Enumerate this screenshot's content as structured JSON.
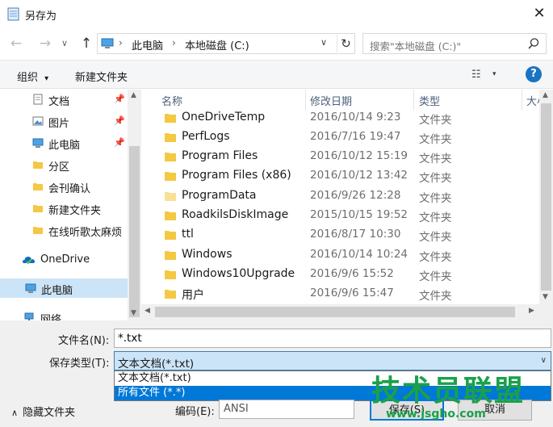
{
  "window": {
    "title": "另存为",
    "close_glyph": "✕"
  },
  "nav": {
    "back_glyph": "←",
    "forward_glyph": "→",
    "dropdown_glyph": "∨",
    "up_glyph": "↑",
    "breadcrumb": [
      "此电脑",
      "本地磁盘 (C:)"
    ],
    "crumb_separator": "›",
    "address_dropdown_glyph": "∨",
    "refresh_glyph": "↻",
    "search_placeholder": "搜索\"本地磁盘 (C:)\""
  },
  "toolbar": {
    "organize_label": "组织",
    "organize_caret": "▾",
    "new_folder_label": "新建文件夹",
    "view_glyph": "☷",
    "view_caret": "▾",
    "help_glyph": "?"
  },
  "sidebar": {
    "pin_glyph": "📌",
    "items": [
      {
        "label": "文档",
        "icon": "document-icon",
        "pinned": true
      },
      {
        "label": "图片",
        "icon": "picture-icon",
        "pinned": true
      },
      {
        "label": "此电脑",
        "icon": "computer-icon",
        "pinned": true
      },
      {
        "label": "分区",
        "icon": "folder-icon",
        "pinned": false
      },
      {
        "label": "会刊确认",
        "icon": "folder-icon",
        "pinned": false
      },
      {
        "label": "新建文件夹",
        "icon": "folder-icon",
        "pinned": false
      },
      {
        "label": "在线听歌太麻烦",
        "icon": "folder-icon",
        "pinned": false
      },
      {
        "label": "OneDrive",
        "icon": "onedrive-icon",
        "pinned": false
      },
      {
        "label": "此电脑",
        "icon": "computer-icon",
        "pinned": false,
        "selected": true
      },
      {
        "label": "网络",
        "icon": "network-icon",
        "pinned": false
      }
    ]
  },
  "file_list": {
    "columns": {
      "name": "名称",
      "date": "修改日期",
      "type": "类型",
      "size": "大小"
    },
    "sort_glyph": "^",
    "rows": [
      {
        "name": "OneDriveTemp",
        "date": "2016/10/14 9:23",
        "type": "文件夹"
      },
      {
        "name": "PerfLogs",
        "date": "2016/7/16 19:47",
        "type": "文件夹"
      },
      {
        "name": "Program Files",
        "date": "2016/10/12 15:19",
        "type": "文件夹"
      },
      {
        "name": "Program Files (x86)",
        "date": "2016/10/12 13:42",
        "type": "文件夹"
      },
      {
        "name": "ProgramData",
        "date": "2016/9/26 12:28",
        "type": "文件夹",
        "hidden": true
      },
      {
        "name": "RoadkilsDiskImage",
        "date": "2015/10/15 19:52",
        "type": "文件夹"
      },
      {
        "name": "ttl",
        "date": "2016/8/17 10:30",
        "type": "文件夹"
      },
      {
        "name": "Windows",
        "date": "2016/10/14 10:24",
        "type": "文件夹"
      },
      {
        "name": "Windows10Upgrade",
        "date": "2016/9/6 15:52",
        "type": "文件夹"
      },
      {
        "name": "用户",
        "date": "2016/9/6 15:47",
        "type": "文件夹"
      }
    ]
  },
  "scroll": {
    "up": "▲",
    "down": "▼",
    "left": "◀",
    "right": "▶"
  },
  "save_form": {
    "filename_label": "文件名(N):",
    "filename_value": "*.txt",
    "filetype_label": "保存类型(T):",
    "filetype_value": "文本文档(*.txt)",
    "filetype_caret": "∨",
    "filetype_options": [
      "文本文档(*.txt)",
      "所有文件  (*.*)"
    ],
    "hide_folders_label": "隐藏文件夹",
    "hide_folders_glyph": "∧",
    "encoding_label": "编码(E):",
    "encoding_value": "ANSI",
    "save_button": "保存(S)",
    "cancel_button": "取消"
  },
  "watermark": {
    "text": "技术员联盟",
    "url": "www.jsgho.com"
  },
  "colors": {
    "accent": "#0078d7",
    "selection": "#cce4f7",
    "folder": "#f4c843",
    "help": "#1a74c4",
    "watermark": "#1aa14a"
  }
}
